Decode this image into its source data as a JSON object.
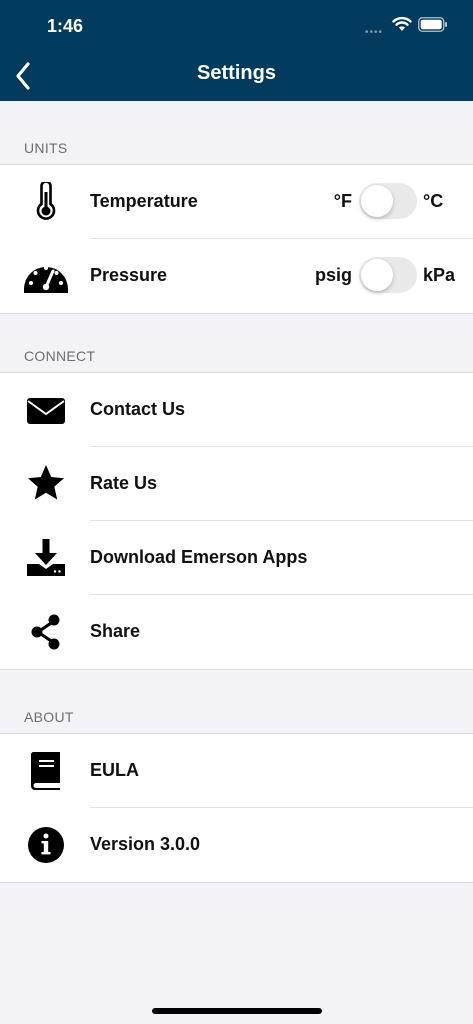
{
  "status_bar": {
    "time": "1:46",
    "wifi_icon": "wifi-icon",
    "battery_icon": "battery-icon"
  },
  "header": {
    "title": "Settings",
    "back_icon": "chevron-left-icon"
  },
  "sections": {
    "units": {
      "title": "UNITS",
      "rows": [
        {
          "label": "Temperature",
          "icon": "thermometer-icon",
          "left_unit": "°F",
          "right_unit": "°C",
          "toggle_on": false
        },
        {
          "label": "Pressure",
          "icon": "gauge-icon",
          "left_unit": "psig",
          "right_unit": "kPa",
          "toggle_on": false
        }
      ]
    },
    "connect": {
      "title": "CONNECT",
      "rows": [
        {
          "label": "Contact Us",
          "icon": "envelope-icon"
        },
        {
          "label": "Rate Us",
          "icon": "star-icon"
        },
        {
          "label": "Download Emerson Apps",
          "icon": "download-icon"
        },
        {
          "label": "Share",
          "icon": "share-icon"
        }
      ]
    },
    "about": {
      "title": "ABOUT",
      "rows": [
        {
          "label": "EULA",
          "icon": "book-icon"
        },
        {
          "label": "Version 3.0.0",
          "icon": "info-icon"
        }
      ]
    }
  },
  "colors": {
    "header_bg": "#003a5c",
    "page_bg": "#f2f2f7",
    "toggle_off": "#e9e9ea"
  }
}
